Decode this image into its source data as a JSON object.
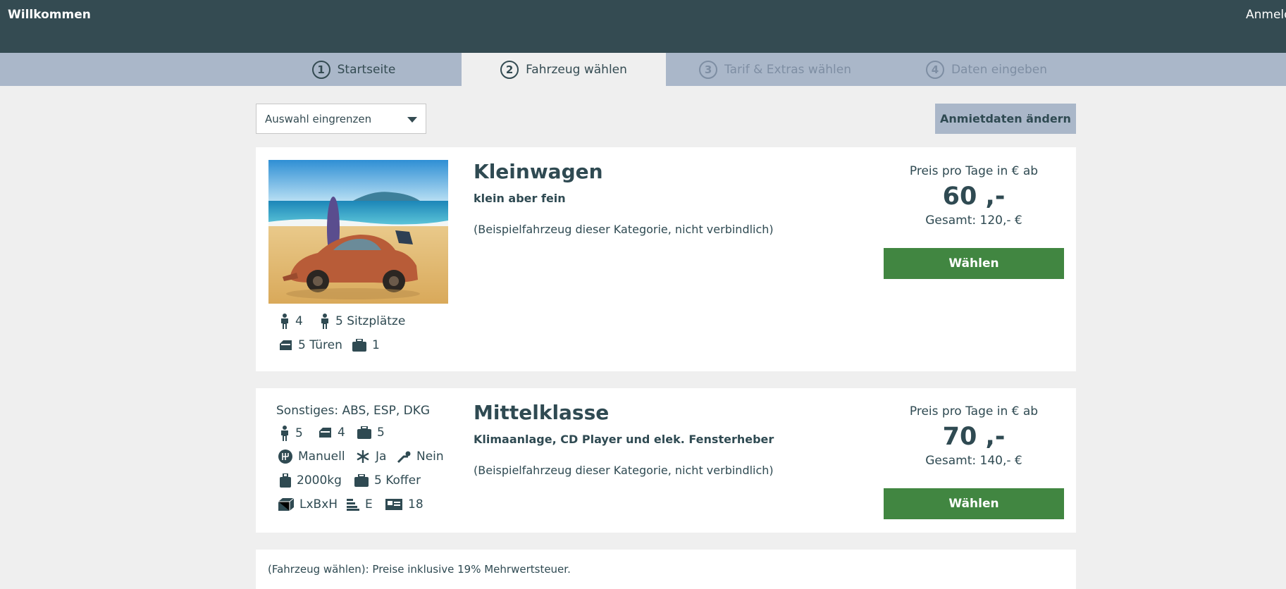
{
  "header": {
    "welcome": "Willkommen",
    "login": "Anmelden"
  },
  "steps": [
    {
      "num": "1",
      "label": "Startseite"
    },
    {
      "num": "2",
      "label": "Fahrzeug wählen"
    },
    {
      "num": "3",
      "label": "Tarif & Extras wählen"
    },
    {
      "num": "4",
      "label": "Daten eingeben"
    }
  ],
  "filter": {
    "label": "Auswahl eingrenzen"
  },
  "change_button": "Anmietdaten ändern",
  "cars": [
    {
      "title": "Kleinwagen",
      "subtitle": "klein aber fein",
      "note": "(Beispielfahrzeug dieser Kategorie, nicht verbindlich)",
      "price_label": "Preis pro Tage in € ab",
      "price": "60 ,-",
      "total": "Gesamt: 120,- €",
      "button": "Wählen",
      "features": {
        "persons": "4",
        "seats": "5 Sitzplätze",
        "doors": "5 Türen",
        "luggage": "1"
      }
    },
    {
      "title": "Mittelklasse",
      "subtitle": "Klimaanlage, CD Player und elek. Fensterheber",
      "note": "(Beispielfahrzeug dieser Kategorie, nicht verbindlich)",
      "price_label": "Preis pro Tage in € ab",
      "price": "70 ,-",
      "total": "Gesamt: 140,- €",
      "button": "Wählen",
      "features": {
        "other": "Sonstiges: ABS, ESP, DKG",
        "persons": "5",
        "doors": "4",
        "luggage": "5",
        "gear": "Manuell",
        "ac": "Ja",
        "trailer": "Nein",
        "weight": "2000kg",
        "suitcases": "5 Koffer",
        "dimensions": "LxBxH",
        "class": "E",
        "age": "18"
      }
    }
  ],
  "footer_note": "(Fahrzeug wählen): Preise inklusive 19% Mehrwertsteuer."
}
